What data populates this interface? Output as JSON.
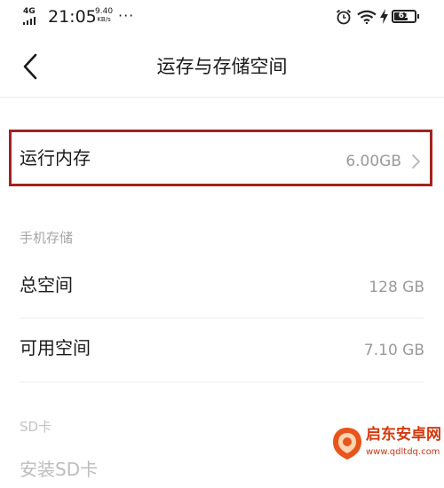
{
  "status_bar": {
    "network": "4G",
    "time": "21:05",
    "speed_value": "9.40",
    "speed_unit": "KB/s",
    "more": "···",
    "battery_level": "61",
    "icons": [
      "signal-icon",
      "alarm-icon",
      "wifi-icon",
      "charging-icon",
      "battery-icon"
    ]
  },
  "nav": {
    "back_icon": "chevron-left-icon",
    "title": "运存与存储空间"
  },
  "ram": {
    "label": "运行内存",
    "value": "6.00GB",
    "chevron_icon": "chevron-right-icon",
    "highlight_color": "#a1231f"
  },
  "phone_storage": {
    "header": "手机存储",
    "total_label": "总空间",
    "total_value": "128 GB",
    "available_label": "可用空间",
    "available_value": "7.10 GB"
  },
  "sd_card": {
    "header": "SD卡",
    "install_label": "安装SD卡"
  },
  "watermark": {
    "title": "启东安卓网",
    "url": "www.qdltdq.com"
  }
}
